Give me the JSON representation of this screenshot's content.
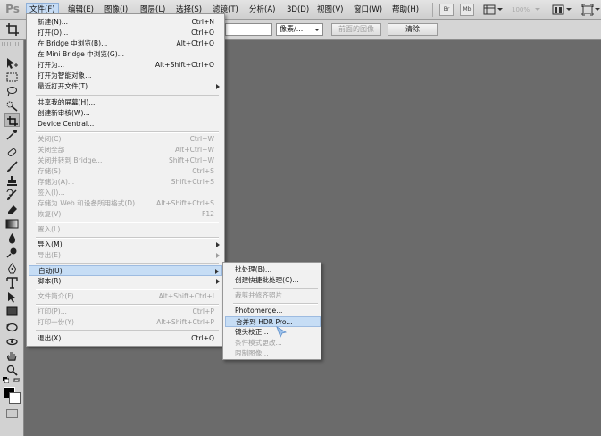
{
  "app": {
    "logo": "Ps"
  },
  "menubar": {
    "items": [
      {
        "label": "文件(F)",
        "active": true
      },
      {
        "label": "编辑(E)"
      },
      {
        "label": "图像(I)"
      },
      {
        "label": "图层(L)"
      },
      {
        "label": "选择(S)"
      },
      {
        "label": "滤镜(T)"
      },
      {
        "label": "分析(A)"
      },
      {
        "label": "3D(D)"
      },
      {
        "label": "视图(V)"
      },
      {
        "label": "窗口(W)"
      },
      {
        "label": "帮助(H)"
      }
    ],
    "buttons": {
      "bridge": "Br",
      "minibridge": "Mb"
    },
    "zoom": "100%"
  },
  "options": {
    "units": "像素/...",
    "front_image_label": "前面的图像",
    "clear_label": "清除"
  },
  "file_menu": {
    "items": [
      {
        "label": "新建(N)...",
        "shortcut": "Ctrl+N"
      },
      {
        "label": "打开(O)...",
        "shortcut": "Ctrl+O"
      },
      {
        "label": "在 Bridge 中浏览(B)...",
        "shortcut": "Alt+Ctrl+O"
      },
      {
        "label": "在 Mini Bridge 中浏览(G)...",
        "shortcut": ""
      },
      {
        "label": "打开为...",
        "shortcut": "Alt+Shift+Ctrl+O"
      },
      {
        "label": "打开为智能对象...",
        "shortcut": ""
      },
      {
        "label": "最近打开文件(T)",
        "shortcut": ""
      },
      {
        "label": "共享我的屏幕(H)...",
        "shortcut": ""
      },
      {
        "label": "创建新审核(W)...",
        "shortcut": ""
      },
      {
        "label": "Device Central...",
        "shortcut": ""
      },
      {
        "label": "关闭(C)",
        "shortcut": "Ctrl+W"
      },
      {
        "label": "关闭全部",
        "shortcut": "Alt+Ctrl+W"
      },
      {
        "label": "关闭并转到 Bridge...",
        "shortcut": "Shift+Ctrl+W"
      },
      {
        "label": "存储(S)",
        "shortcut": "Ctrl+S"
      },
      {
        "label": "存储为(A)...",
        "shortcut": "Shift+Ctrl+S"
      },
      {
        "label": "签入(I)...",
        "shortcut": ""
      },
      {
        "label": "存储为 Web 和设备所用格式(D)...",
        "shortcut": "Alt+Shift+Ctrl+S"
      },
      {
        "label": "恢复(V)",
        "shortcut": "F12"
      },
      {
        "label": "置入(L)...",
        "shortcut": ""
      },
      {
        "label": "导入(M)",
        "shortcut": ""
      },
      {
        "label": "导出(E)",
        "shortcut": ""
      },
      {
        "label": "自动(U)",
        "shortcut": ""
      },
      {
        "label": "脚本(R)",
        "shortcut": ""
      },
      {
        "label": "文件简介(F)...",
        "shortcut": "Alt+Shift+Ctrl+I"
      },
      {
        "label": "打印(P)...",
        "shortcut": "Ctrl+P"
      },
      {
        "label": "打印一份(Y)",
        "shortcut": "Alt+Shift+Ctrl+P"
      },
      {
        "label": "退出(X)",
        "shortcut": "Ctrl+Q"
      }
    ]
  },
  "automate_menu": {
    "items": [
      {
        "label": "批处理(B)..."
      },
      {
        "label": "创建快捷批处理(C)..."
      },
      {
        "label": "裁剪并修齐照片"
      },
      {
        "label": "Photomerge..."
      },
      {
        "label": "合并到 HDR Pro..."
      },
      {
        "label": "镜头校正..."
      },
      {
        "label": "条件模式更改..."
      },
      {
        "label": "限制图像..."
      }
    ]
  }
}
